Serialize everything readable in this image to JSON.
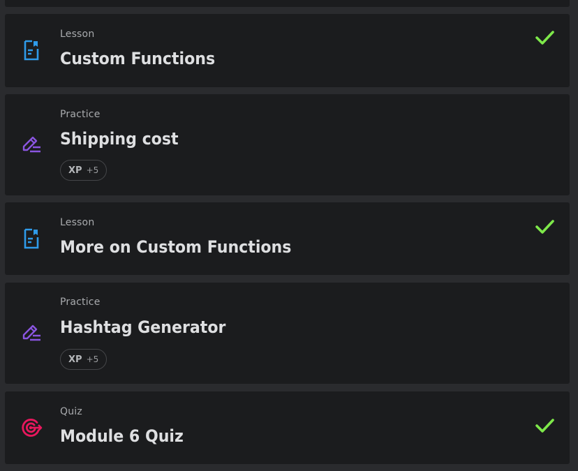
{
  "colors": {
    "lesson_icon": "#2f9bea",
    "practice_icon": "#8a55e0",
    "quiz_icon": "#e8175d",
    "check": "#7ee84a",
    "card_bg": "#1b1c1e",
    "page_bg": "#2a2b2e"
  },
  "items": [
    {
      "kind": "Lesson",
      "title": "Custom Functions",
      "icon": "lesson-document-icon",
      "completed": true
    },
    {
      "kind": "Practice",
      "title": "Shipping cost",
      "icon": "practice-pencil-icon",
      "xp_label": "XP",
      "xp_value": "+5",
      "completed": false
    },
    {
      "kind": "Lesson",
      "title": "More on Custom Functions",
      "icon": "lesson-document-icon",
      "completed": true
    },
    {
      "kind": "Practice",
      "title": "Hashtag Generator",
      "icon": "practice-pencil-icon",
      "xp_label": "XP",
      "xp_value": "+5",
      "completed": false
    },
    {
      "kind": "Quiz",
      "title": "Module 6 Quiz",
      "icon": "quiz-target-icon",
      "completed": true
    }
  ]
}
